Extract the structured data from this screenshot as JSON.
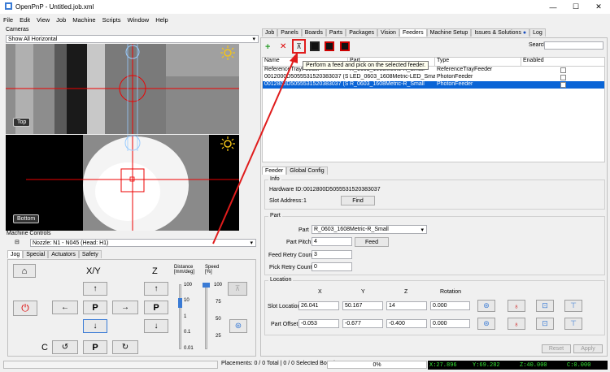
{
  "window": {
    "title": "OpenPnP - Untitled.job.xml",
    "minimize": "—",
    "maximize": "☐",
    "close": "✕"
  },
  "menu": [
    "File",
    "Edit",
    "View",
    "Job",
    "Machine",
    "Scripts",
    "Window",
    "Help"
  ],
  "cameras": {
    "title": "Cameras",
    "view_select": "Show All Horizontal",
    "top_label": "Top",
    "bottom_label": "Bottom"
  },
  "machine_controls": {
    "title": "Machine Controls",
    "nozzle_select": "Nozzle: N1 - N045 (Head: H1)",
    "tabs": [
      "Jog",
      "Special",
      "Actuators",
      "Safety"
    ],
    "xy_label": "X/Y",
    "z_label": "Z",
    "c_label": "C",
    "p_label": "P",
    "distance_label": "Distance [mm/deg]",
    "speed_label": "Speed [%]",
    "distance_ticks": [
      "100",
      "10",
      "1",
      "0.1",
      "0.01"
    ],
    "speed_ticks": [
      "100",
      "75",
      "50",
      "25"
    ],
    "speed_value": 100
  },
  "tabs": [
    "Job",
    "Panels",
    "Boards",
    "Parts",
    "Packages",
    "Vision",
    "Feeders",
    "Machine Setup",
    "Issues & Solutions",
    "Log"
  ],
  "search_label": "Search",
  "tooltip": "Perform a feed and pick on the selected feeder.",
  "table": {
    "headers": [
      "Name",
      "Part",
      "Type",
      "Enabled"
    ],
    "rows": [
      {
        "name": "ReferenceTrayFeeder",
        "part": "R_0603_1608Metric-R_Small",
        "type": "ReferenceTrayFeeder",
        "enabled": false,
        "selected": false
      },
      {
        "name": "0012000D5055531520383037 (Slo...",
        "part": "LED_0603_1608Metric-LED_Small",
        "type": "PhotonFeeder",
        "enabled": false,
        "selected": false
      },
      {
        "name": "0012800D5055531520383037 (Slo...",
        "part": "R_0603_1608Metric-R_Small",
        "type": "PhotonFeeder",
        "enabled": false,
        "selected": true
      }
    ]
  },
  "feeder_tabs": [
    "Feeder",
    "Global Config"
  ],
  "info": {
    "title": "Info",
    "hw_label": "Hardware ID:",
    "hw_value": "0012800D5055531520383037",
    "slot_label": "Slot Address:",
    "slot_value": "1",
    "find": "Find"
  },
  "part": {
    "title": "Part",
    "part_label": "Part",
    "part_value": "R_0603_1608Metric-R_Small",
    "pitch_label": "Part Pitch",
    "pitch_value": "4",
    "feed": "Feed",
    "feed_retry_label": "Feed Retry Count",
    "feed_retry_value": "3",
    "pick_retry_label": "Pick Retry Count",
    "pick_retry_value": "0"
  },
  "location": {
    "title": "Location",
    "cols": [
      "X",
      "Y",
      "Z",
      "Rotation"
    ],
    "slot_label": "Slot Location",
    "slot": [
      "26.041",
      "50.167",
      "14",
      "0.000"
    ],
    "offset_label": "Part Offset",
    "offset": [
      "-0.053",
      "-0.677",
      "-0.400",
      "0.000"
    ]
  },
  "reset": "Reset",
  "apply": "Apply",
  "status": {
    "placements": "Placements: 0 / 0 Total | 0 / 0 Selected Board",
    "progress": "0%",
    "x": "X:27.896",
    "y": "Y:69.282",
    "z": "Z:40.000",
    "c": "C:0.000"
  }
}
